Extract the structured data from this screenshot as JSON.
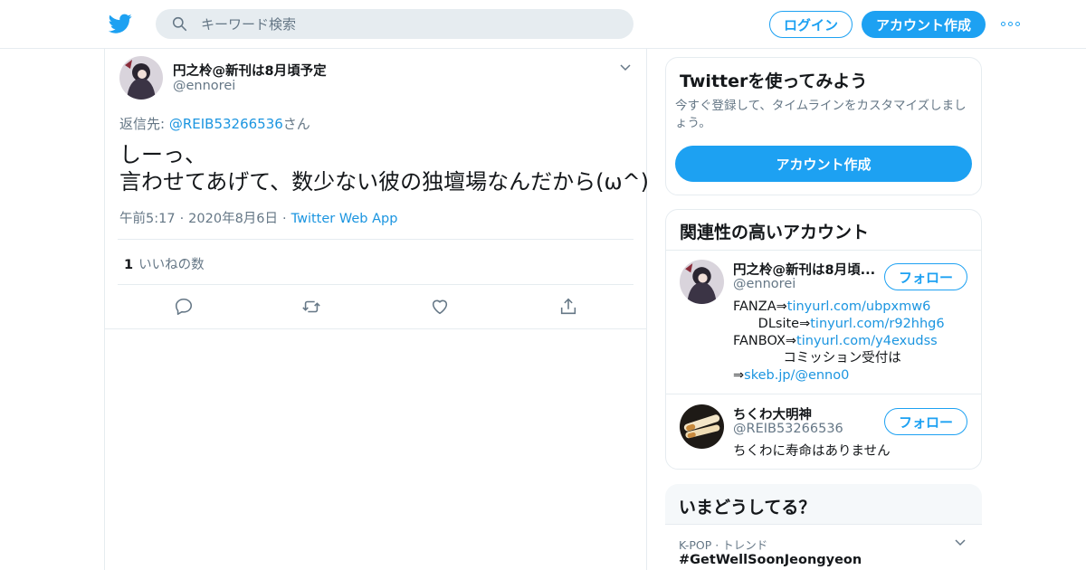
{
  "header": {
    "search_placeholder": "キーワード検索",
    "login_label": "ログイン",
    "signup_label": "アカウント作成"
  },
  "tweet": {
    "author_name": "円之柃@新刊は8月頃予定",
    "author_handle": "@ennorei",
    "reply_prefix": "返信先: ",
    "reply_to": "@REIB53266536",
    "reply_suffix": "さん",
    "text_line1": "しーっ、",
    "text_line2": "言わせてあげて、数少ない彼の独壇場なんだから(ω^)",
    "time": "午前5:17",
    "date": "2020年8月6日",
    "source": "Twitter Web App",
    "meta_separator": "·",
    "likes_count": "1",
    "likes_label": "いいねの数"
  },
  "signup_card": {
    "title": "Twitterを使ってみよう",
    "description": "今すぐ登録して、タイムラインをカスタマイズしましょう。",
    "button_label": "アカウント作成"
  },
  "related": {
    "title": "関連性の高いアカウント",
    "accounts": [
      {
        "name": "円之柃@新刊は8月頃...",
        "handle": "@ennorei",
        "follow_label": "フォロー",
        "bio": [
          {
            "prefix": "FANZA⇒",
            "link": "tinyurl.com/ubpxmw6",
            "indent": ""
          },
          {
            "prefix": "DLsite⇒",
            "link": "tinyurl.com/r92hhg6",
            "indent": "      "
          },
          {
            "prefix": "FANBOX⇒",
            "link": "tinyurl.com/y4exudss",
            "indent": ""
          },
          {
            "prefix": "コミッション受付は",
            "link": "",
            "indent": "            "
          },
          {
            "prefix": "⇒",
            "link": "skeb.jp/@enno0",
            "indent": ""
          }
        ]
      },
      {
        "name": "ちくわ大明神",
        "handle": "@REIB53266536",
        "follow_label": "フォロー",
        "bio_text": "ちくわに寿命はありません"
      }
    ]
  },
  "trends": {
    "title": "いまどうしてる？",
    "items": [
      {
        "meta": "K-POP · トレンド",
        "name": "#GetWellSoonJeongyeon"
      }
    ]
  },
  "colors": {
    "accent": "#1da1f2",
    "link": "#1b95e0",
    "text_secondary": "#657786",
    "divider": "#e6ecf0"
  }
}
